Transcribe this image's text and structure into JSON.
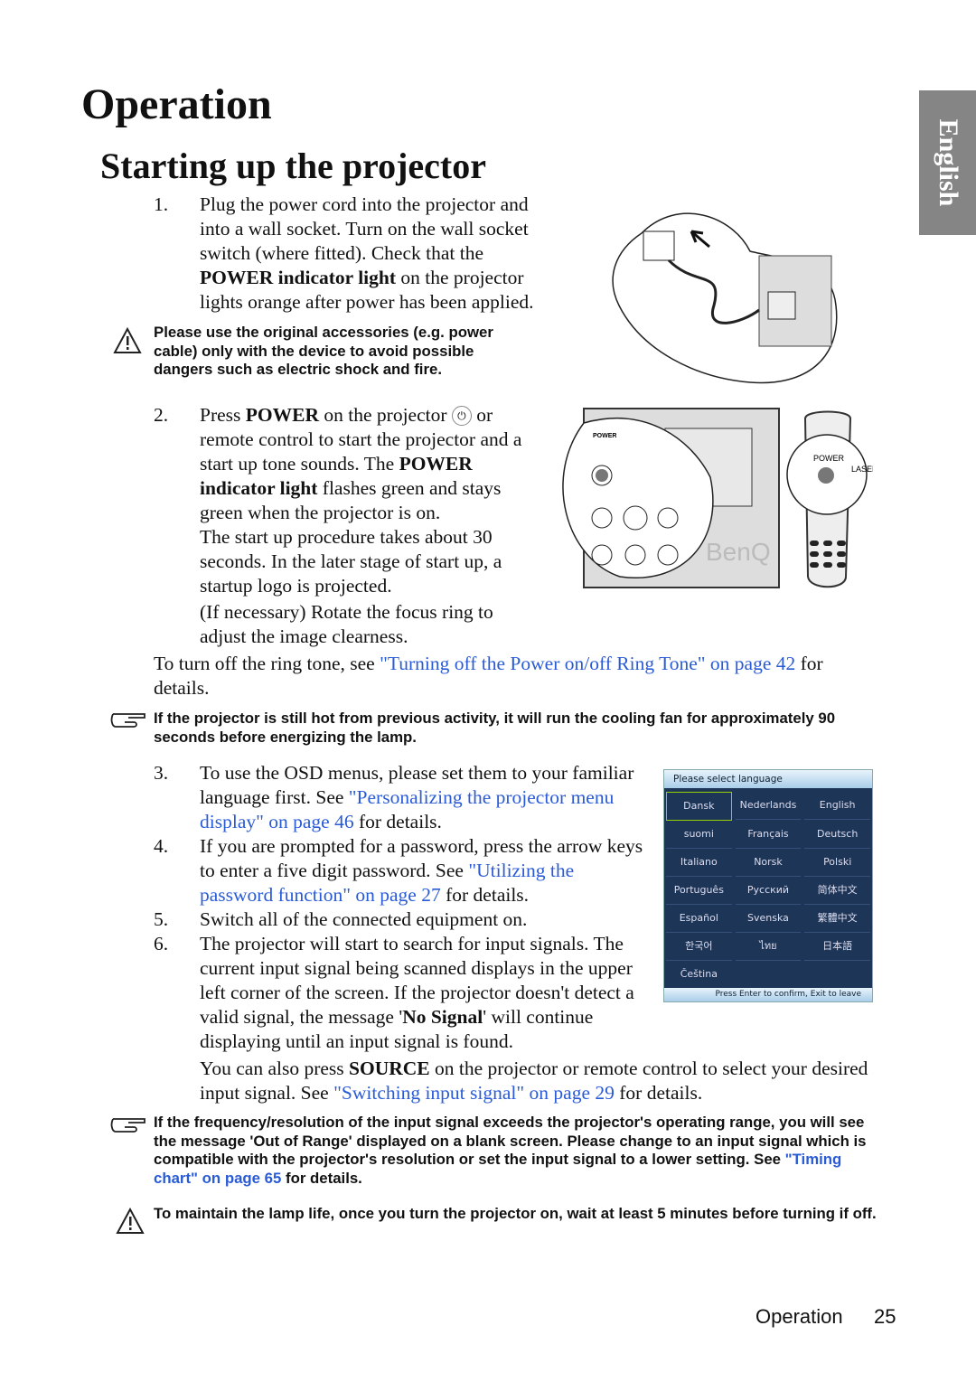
{
  "side_tab": "English",
  "title": "Operation",
  "section_title": "Starting up the projector",
  "step1": {
    "num": "1.",
    "t1": "Plug the power cord into the projector and into a wall socket. Turn on the wall socket switch (where fitted). Check that the ",
    "b1": "POWER indicator light",
    "t2": " on the projector lights orange after power has been applied."
  },
  "warning1": "Please use the original accessories (e.g. power cable) only with the device to avoid possible dangers such as electric shock and fire.",
  "step2": {
    "num": "2.",
    "t1": "Press ",
    "b1": "POWER",
    "t2": " on the projector ",
    "t3": " or remote control to start the projector and a start up tone sounds. The ",
    "b2": "POWER indicator light",
    "t4": " flashes green and stays green when the projector is on.",
    "p2": "The start up procedure takes about 30 seconds. In the later stage of start up, a startup logo is projected.",
    "p3": "(If necessary) Rotate the focus ring to adjust the image clearness."
  },
  "ringtone": {
    "t1": "To turn off the ring tone, see ",
    "link": "\"Turning off the Power on/off Ring Tone\" on page 42",
    "t2": " for details."
  },
  "note1": "If the projector is still hot from previous activity, it will run the cooling fan for approximately 90 seconds before energizing the lamp.",
  "step3": {
    "num": "3.",
    "t1": "To use the OSD menus, please set them to your familiar language first. See ",
    "link": "\"Personalizing the projector menu display\" on page 46",
    "t2": " for details."
  },
  "step4": {
    "num": "4.",
    "t1": "If you are prompted for a password, press the arrow keys to enter a five digit password. See ",
    "link": "\"Utilizing the password function\" on page 27",
    "t2": " for details."
  },
  "step5": {
    "num": "5.",
    "t1": "Switch all of the connected equipment on."
  },
  "step6": {
    "num": "6.",
    "t1": "The projector will start to search for input signals. The current input signal being scanned displays in the upper left corner of the screen. If the projector doesn't detect a valid signal, the message '",
    "b1": "No Signal",
    "t2": "' will continue displaying until an input signal is found."
  },
  "source": {
    "t1": "You can also press ",
    "b1": "SOURCE",
    "t2": " on the projector or remote control to select your desired input signal. See ",
    "link": "\"Switching input signal\" on page 29",
    "t3": " for details."
  },
  "note2": {
    "t1": "If the frequency/resolution of the input signal exceeds the projector's operating range, you will see the message 'Out of Range' displayed on a blank screen. Please change to an input signal which is compatible with the projector's resolution or set the input signal to a lower setting. See ",
    "link": "\"Timing chart\" on page 65",
    "t2": " for details."
  },
  "warning2": "To maintain the lamp life, once you turn the projector on, wait at least 5 minutes before turning if off.",
  "osd": {
    "header": "Please select language",
    "selected": "Dansk",
    "languages": [
      "Dansk",
      "Nederlands",
      "English",
      "suomi",
      "Français",
      "Deutsch",
      "Italiano",
      "Norsk",
      "Polski",
      "Português",
      "Русский",
      "简体中文",
      "Español",
      "Svenska",
      "繁體中文",
      "한국어",
      "ไทย",
      "日本語",
      "Čeština"
    ],
    "footer": "Press Enter to confirm, Exit to leave"
  },
  "illustration": {
    "panel_power": "POWER",
    "remote_power": "POWER",
    "remote_laser": "LASER",
    "brand": "BenQ"
  },
  "footer": {
    "section": "Operation",
    "page": "25"
  },
  "colors": {
    "link": "#2a5bd7",
    "tab": "#858585",
    "osd_bg": "#1d3557"
  }
}
